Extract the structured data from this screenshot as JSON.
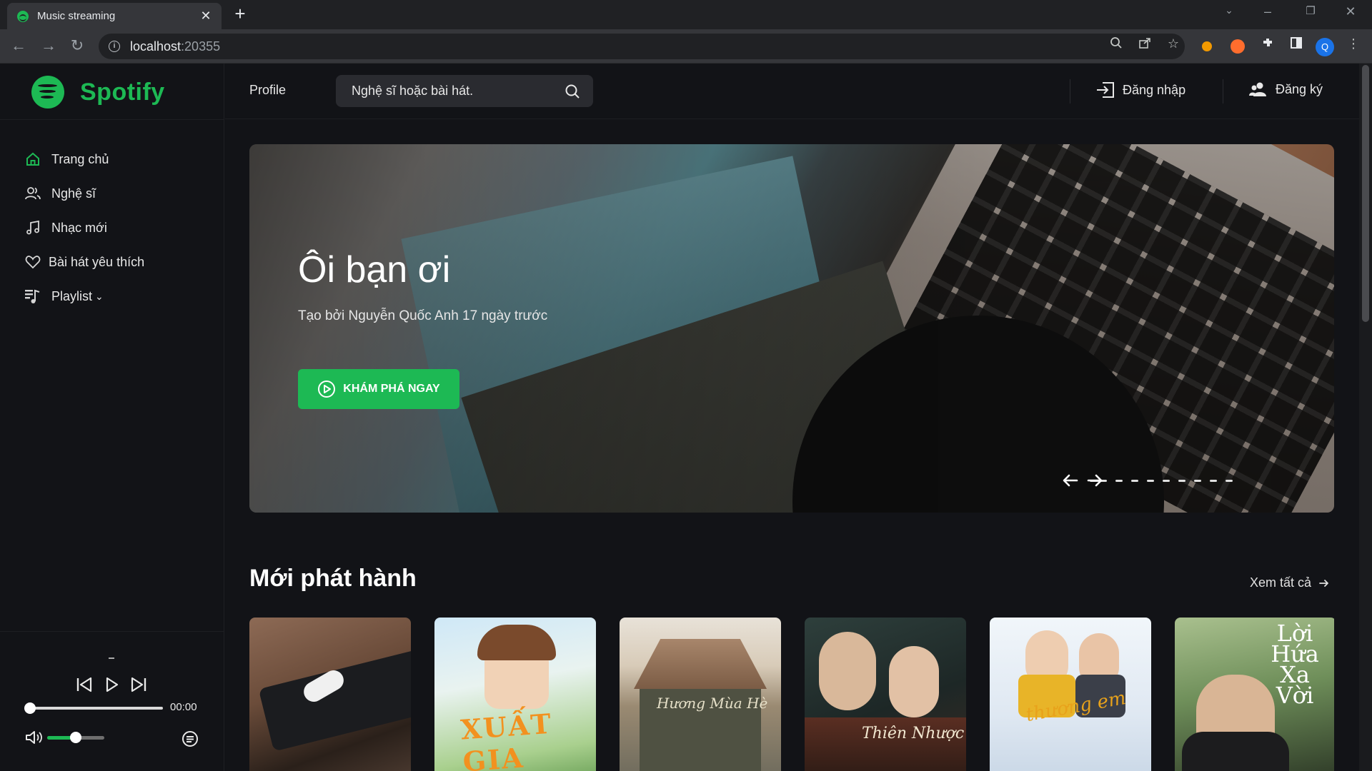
{
  "browser": {
    "tab_title": "Music streaming",
    "tab_close": "✕",
    "new_tab": "+",
    "host": "localhost",
    "port": ":20355",
    "profile_initial": "Q"
  },
  "app": {
    "logo_text": "Spotify",
    "header": {
      "profile_label": "Profile",
      "search_placeholder": "Nghệ sĩ hoặc bài hát.",
      "login_label": "Đăng nhập",
      "register_label": "Đăng ký"
    },
    "sidebar": {
      "items": [
        {
          "label": "Trang chủ",
          "icon": "home-icon",
          "active": true
        },
        {
          "label": "Nghệ sĩ",
          "icon": "users-icon",
          "active": false
        },
        {
          "label": "Nhạc mới",
          "icon": "music-note-icon",
          "active": false
        },
        {
          "label": "Bài hát yêu thích",
          "icon": "heart-icon",
          "active": false
        },
        {
          "label": "Playlist",
          "icon": "playlist-icon",
          "active": false,
          "chevron": "⌄"
        }
      ]
    },
    "player": {
      "time": "00:00",
      "progress": 0,
      "volume": 0.5
    },
    "hero": {
      "title": "Ôi bạn ơi",
      "subtitle": "Tạo bởi Nguyễn Quốc Anh 17 ngày trước",
      "cta_label": "KHÁM PHÁ NGAY",
      "slide_count": 9,
      "active_slide": 0
    },
    "new_releases": {
      "title": "Mới phát hành",
      "see_all": "Xem tất cả",
      "cards": [
        {
          "name": "earbuds-cover",
          "art_text": ""
        },
        {
          "name": "xuat-gia-cover",
          "art_text": "XUẤT GIA"
        },
        {
          "name": "house-cover",
          "art_text": "Hương Mùa Hè"
        },
        {
          "name": "traditional-cover",
          "art_text": "Thiên Nhược"
        },
        {
          "name": "thuong-em-cover",
          "art_text": "thương em"
        },
        {
          "name": "loi-hua-cover",
          "art_text": "Lời Hứa Xa Vời"
        }
      ]
    }
  }
}
